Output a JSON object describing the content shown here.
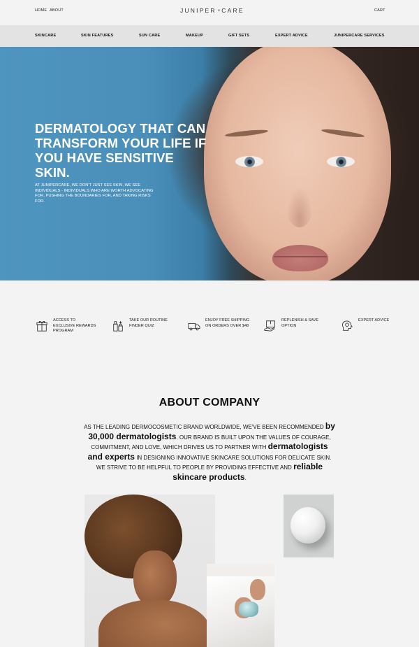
{
  "top_nav": {
    "home": "HOME",
    "about": "ABOUT",
    "brand": {
      "left": "JUNIPER",
      "separator": "×",
      "right": "CARE"
    },
    "cart": "CART"
  },
  "main_nav": [
    "SKINCARE",
    "SKIN FEATURES",
    "SUN CARE",
    "MAKEUP",
    "GIFT SETS",
    "EXPERT ADVICE",
    "JUNIPERCARE SERVICES"
  ],
  "hero": {
    "title": "DERMATOLOGY THAT CAN TRANSFORM YOUR LIFE IF YOU HAVE SENSITIVE SKIN.",
    "text": "AT JUNIPERCARE, WE DON'T JUST SEE SKIN, WE SEE INDIVIDUALS - INDIVIDUALS WHO ARE WORTH ADVOCATING FOR, PUSHING THE BOUNDARIES FOR, AND TAKING RISKS FOR."
  },
  "features": [
    {
      "icon": "gift-icon",
      "label": "ACCESS TO EXCLUSIVE REWARDS PROGRAM"
    },
    {
      "icon": "bottles-icon",
      "label": "TAKE OUR ROUTINE FINDER QUIZ"
    },
    {
      "icon": "truck-icon",
      "label": "ENJOY FREE SHIPPING ON ORDERS OVER $48"
    },
    {
      "icon": "replenish-icon",
      "label": "REPLENISH & SAVE OPTION"
    },
    {
      "icon": "expert-icon",
      "label": "EXPERT ADVICE"
    }
  ],
  "about": {
    "title": "ABOUT COMPANY",
    "p1": "AS THE LEADING DERMOCOSMETIC BRAND WORLDWIDE, WE'VE BEEN RECOMMENDED ",
    "b1": "by 30,000 dermatologists",
    "p2": ". OUR BRAND IS BUILT UPON THE VALUES OF COURAGE, COMMITMENT, AND LOVE, WHICH DRIVES US TO PARTNER WITH ",
    "b2": "dermatologists and experts",
    "p3": " IN DESIGNING INNOVATIVE SKINCARE SOLUTIONS FOR DELICATE SKIN. WE STRIVE TO BE HELPFUL TO PEOPLE BY PROVIDING EFFECTIVE AND ",
    "b3": "reliable skincare products",
    "p4": "."
  }
}
